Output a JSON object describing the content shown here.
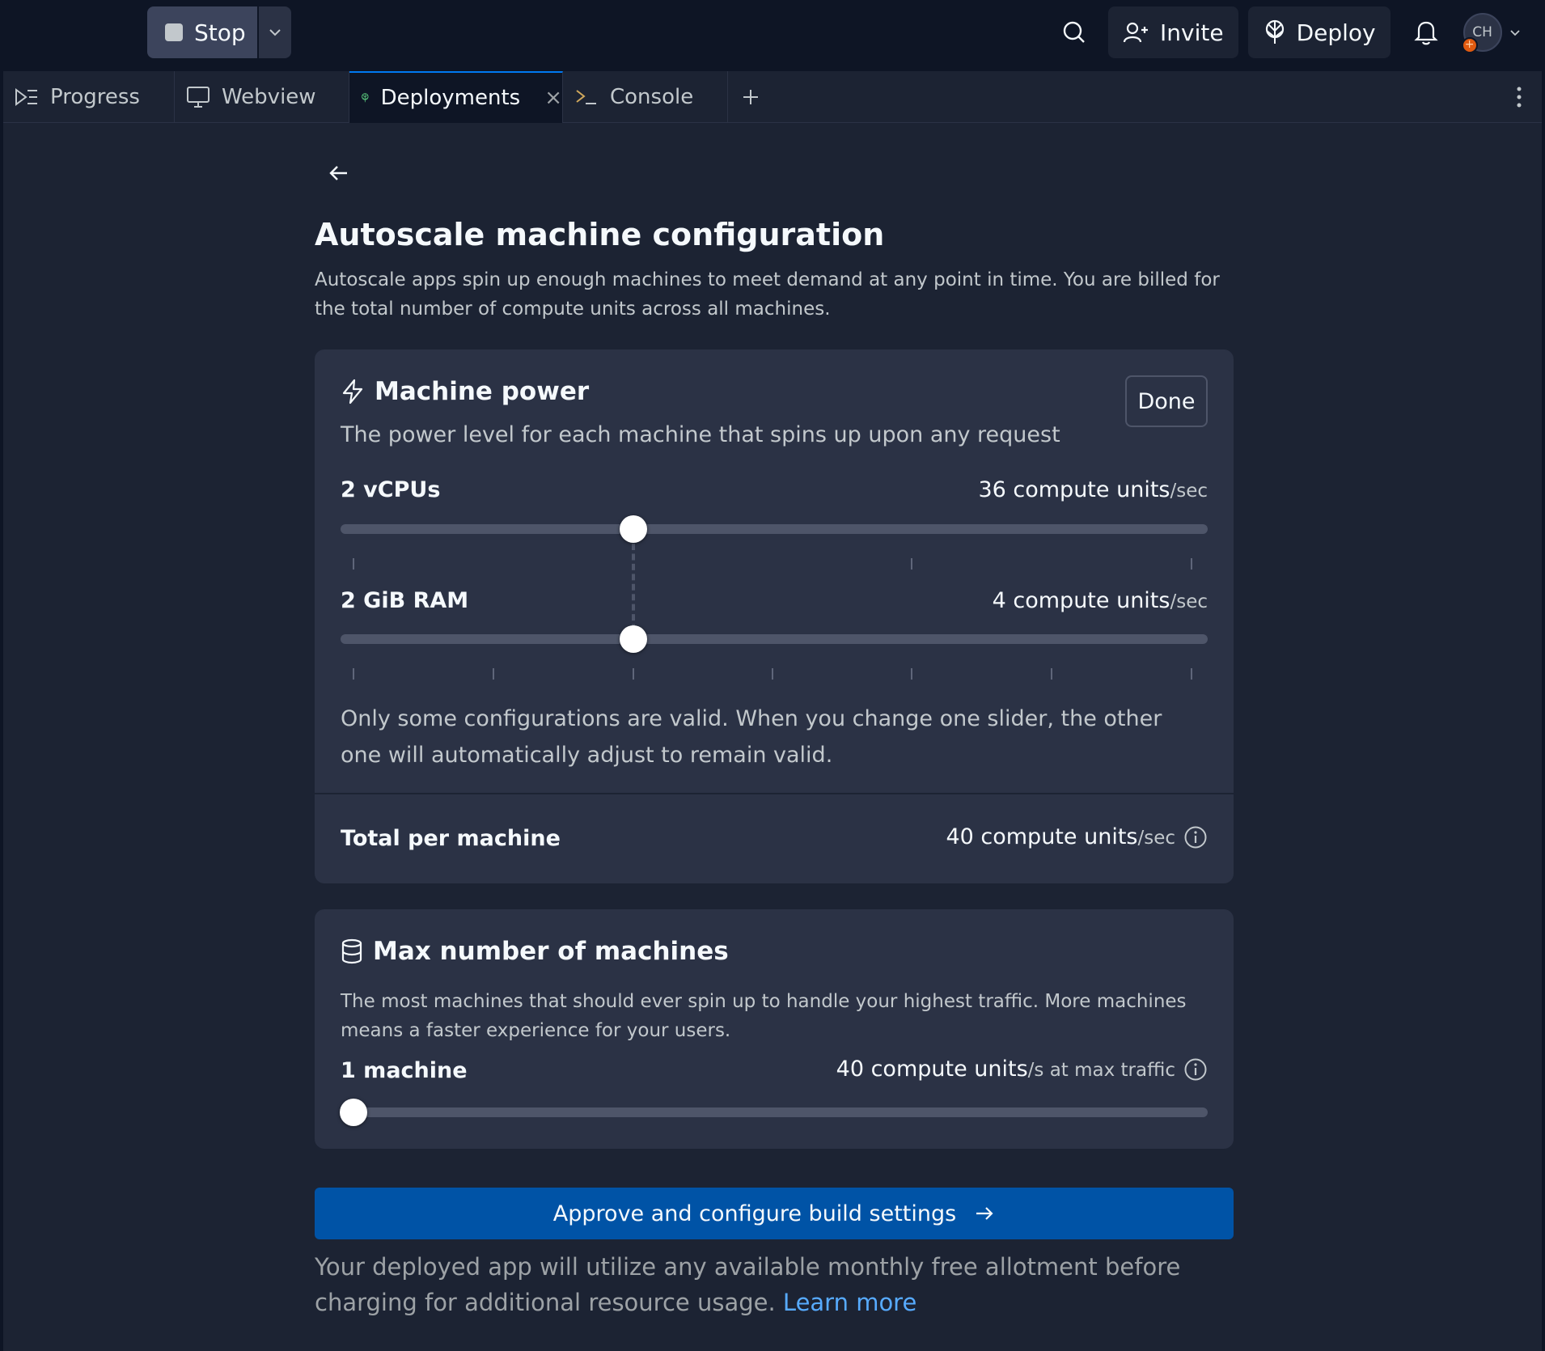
{
  "topbar": {
    "stop_label": "Stop",
    "invite_label": "Invite",
    "deploy_label": "Deploy",
    "avatar_initials": "CH"
  },
  "tabs": [
    {
      "label": "Progress",
      "icon": "progress-icon"
    },
    {
      "label": "Webview",
      "icon": "monitor-icon"
    },
    {
      "label": "Deployments",
      "icon": "deploy-icon",
      "active": true
    },
    {
      "label": "Console",
      "icon": "terminal-icon"
    }
  ],
  "page": {
    "title": "Autoscale machine configuration",
    "description": "Autoscale apps spin up enough machines to meet demand at any point in time. You are billed for the total number of compute units across all machines."
  },
  "machine_power": {
    "title": "Machine power",
    "subtitle": "The power level for each machine that spins up upon any request",
    "done_label": "Done",
    "cpu": {
      "label": "2 vCPUs",
      "value": "36 compute units",
      "unit": "/sec",
      "slider_position": 0.338
    },
    "ram": {
      "label": "2 GiB RAM",
      "value": "4 compute units",
      "unit": "/sec",
      "slider_position": 0.338
    },
    "note": "Only some configurations are valid. When you change one slider, the other one will automatically adjust to remain valid.",
    "total_label": "Total per machine",
    "total_value": "40 compute units",
    "total_unit": "/sec"
  },
  "max_machines": {
    "title": "Max number of machines",
    "subtitle": "The most machines that should ever spin up to handle your highest traffic. More machines means a faster experience for your users.",
    "label": "1 machine",
    "value": "40 compute units",
    "unit": "/s at max traffic",
    "slider_position": 0.0
  },
  "approve_label": "Approve and configure build settings",
  "footer": {
    "text": "Your deployed app will utilize any available monthly free allotment before charging for additional resource usage.",
    "link": "Learn more"
  },
  "colors": {
    "accent": "#0053a6",
    "link": "#57abff",
    "active_tab_border": "#0079f2",
    "deploy_icon": "#58c47a"
  }
}
